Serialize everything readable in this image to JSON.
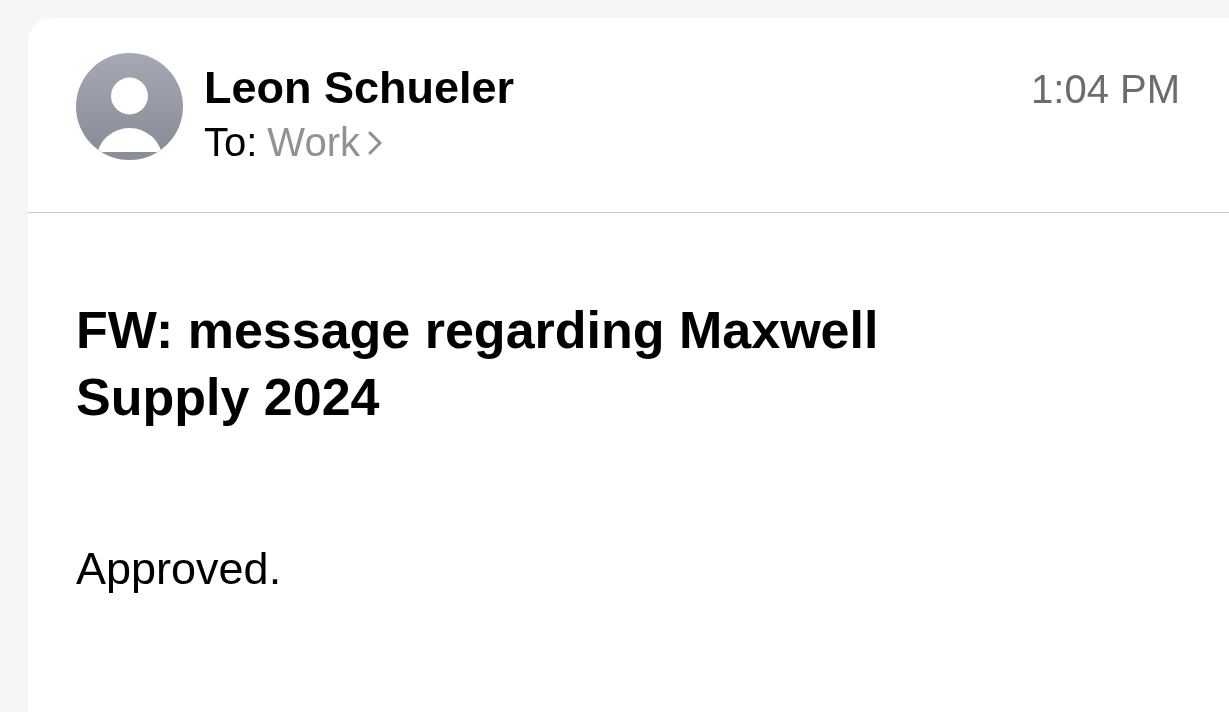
{
  "message": {
    "sender": "Leon Schueler",
    "to_label": "To:",
    "recipient": "Work",
    "time": "1:04 PM",
    "subject": "FW: message regarding Maxwell Supply 2024",
    "body": "Approved."
  }
}
